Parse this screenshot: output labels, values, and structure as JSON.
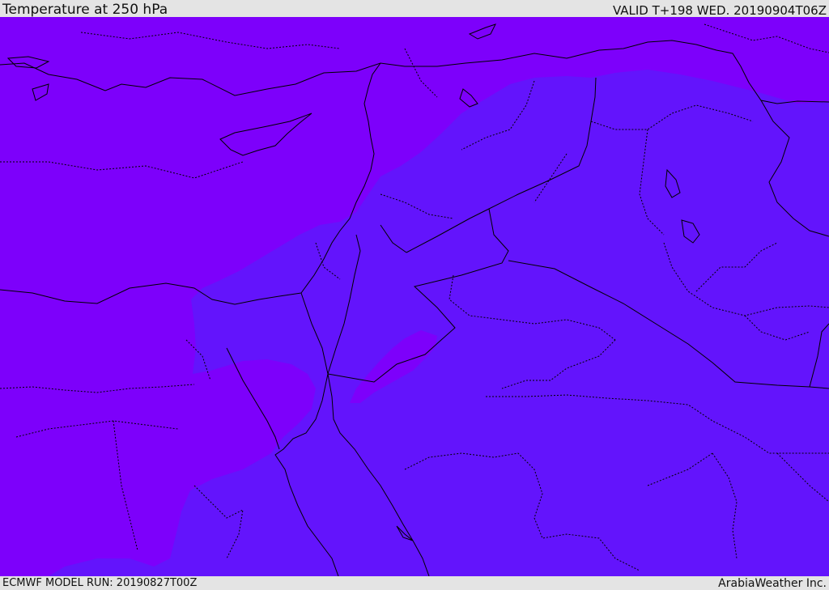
{
  "header": {
    "title": "Temperature at 250 hPa",
    "valid_time": "VALID T+198 WED. 20190904T06Z"
  },
  "footer": {
    "model_run": "ECMWF MODEL RUN: 20190827T00Z",
    "credit": "ArabiaWeather Inc."
  },
  "map": {
    "variable": "Temperature",
    "level": "250 hPa",
    "colors": {
      "colder_band": "#7d00fb",
      "warmer_band": "#6314fc",
      "border_line": "#000000"
    }
  }
}
